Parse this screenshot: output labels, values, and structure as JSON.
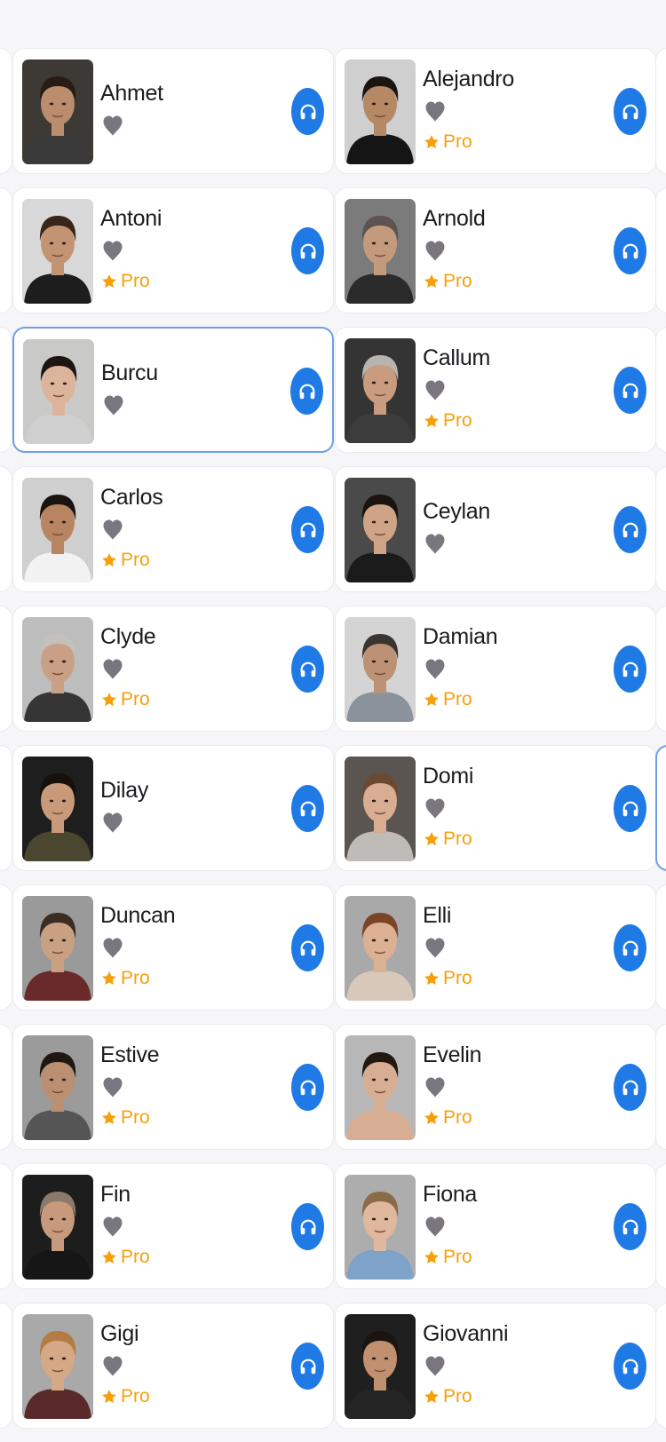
{
  "colors": {
    "listen_button": "#1f7ae5",
    "heart": "#7a7680",
    "pro": "#f5a00a",
    "selected_border": "#6f9ee8"
  },
  "pro_label": "Pro",
  "favorite_icon": "heart-icon",
  "listen_icon": "headphones-icon",
  "pro_icon": "star-icon",
  "voices": [
    {
      "name": "Ahmet",
      "pro": false,
      "selected": false,
      "bg": "#3d3a36",
      "skin": "#b98d6e",
      "hair": "#2a1c14",
      "shirt": "#3a3a3a"
    },
    {
      "name": "Alejandro",
      "pro": true,
      "selected": false,
      "bg": "#cfcfcf",
      "skin": "#b58866",
      "hair": "#1c1410",
      "shirt": "#151515"
    },
    {
      "name": "Antoni",
      "pro": true,
      "selected": false,
      "bg": "#d8d8d8",
      "skin": "#c39473",
      "hair": "#3a2618",
      "shirt": "#1d1d1d"
    },
    {
      "name": "Arnold",
      "pro": true,
      "selected": false,
      "bg": "#7b7b7b",
      "skin": "#c49a7c",
      "hair": "#5b5450",
      "shirt": "#2b2b2b"
    },
    {
      "name": "Burcu",
      "pro": false,
      "selected": true,
      "bg": "#c9c9c7",
      "skin": "#dcb49a",
      "hair": "#1c1512",
      "shirt": "#cfcfcf"
    },
    {
      "name": "Callum",
      "pro": true,
      "selected": false,
      "bg": "#343434",
      "skin": "#c99c80",
      "hair": "#b8b4b0",
      "shirt": "#3c3c3c"
    },
    {
      "name": "Carlos",
      "pro": true,
      "selected": false,
      "bg": "#cfcfcf",
      "skin": "#b88462",
      "hair": "#1a1410",
      "shirt": "#f2f2f2"
    },
    {
      "name": "Ceylan",
      "pro": false,
      "selected": false,
      "bg": "#4a4a4a",
      "skin": "#cfa385",
      "hair": "#1a1310",
      "shirt": "#1b1b1b"
    },
    {
      "name": "Clyde",
      "pro": true,
      "selected": false,
      "bg": "#bdbdbd",
      "skin": "#c9a086",
      "hair": "#c4c0bb",
      "shirt": "#353535"
    },
    {
      "name": "Damian",
      "pro": true,
      "selected": false,
      "bg": "#d4d4d4",
      "skin": "#bd9274",
      "hair": "#3a3530",
      "shirt": "#8a929c"
    },
    {
      "name": "Dilay",
      "pro": false,
      "selected": false,
      "bg": "#1e1e1e",
      "skin": "#c99a7a",
      "hair": "#17100c",
      "shirt": "#4a4630"
    },
    {
      "name": "Domi",
      "pro": true,
      "selected": false,
      "bg": "#5a5550",
      "skin": "#d8ad92",
      "hair": "#6b4a34",
      "shirt": "#bfbcb8"
    },
    {
      "name": "Duncan",
      "pro": true,
      "selected": false,
      "bg": "#9a9a9a",
      "skin": "#caa083",
      "hair": "#3b2d22",
      "shirt": "#6a2a2a"
    },
    {
      "name": "Elli",
      "pro": true,
      "selected": false,
      "bg": "#a9a9a9",
      "skin": "#dcb092",
      "hair": "#7a4526",
      "shirt": "#d7c8ba"
    },
    {
      "name": "Estive",
      "pro": true,
      "selected": false,
      "bg": "#9b9b9b",
      "skin": "#bb8f71",
      "hair": "#1e1712",
      "shirt": "#555555"
    },
    {
      "name": "Evelin",
      "pro": true,
      "selected": false,
      "bg": "#b7b7b7",
      "skin": "#d7ae93",
      "hair": "#221812",
      "shirt": "#d7ae93"
    },
    {
      "name": "Fin",
      "pro": true,
      "selected": false,
      "bg": "#1d1d1d",
      "skin": "#c79a7d",
      "hair": "#8a7a6c",
      "shirt": "#161616"
    },
    {
      "name": "Fiona",
      "pro": true,
      "selected": false,
      "bg": "#adadad",
      "skin": "#dfb89e",
      "hair": "#8b6a48",
      "shirt": "#7ea2c8"
    },
    {
      "name": "Gigi",
      "pro": true,
      "selected": false,
      "bg": "#a9a9a9",
      "skin": "#d5a886",
      "hair": "#b47c42",
      "shirt": "#5a2a2a"
    },
    {
      "name": "Giovanni",
      "pro": true,
      "selected": false,
      "bg": "#1f1f1f",
      "skin": "#c09070",
      "hair": "#1b1410",
      "shirt": "#242424"
    }
  ]
}
